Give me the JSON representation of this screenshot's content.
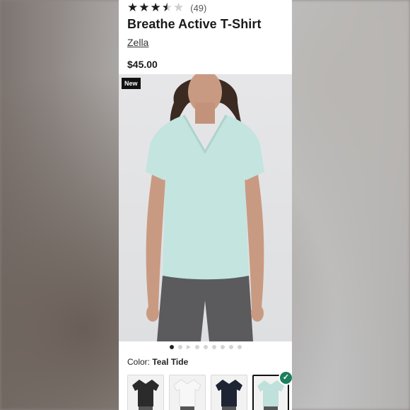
{
  "product": {
    "rating_count": "(49)",
    "title": "Breathe Active T-Shirt",
    "brand": "Zella",
    "price": "$45.00",
    "badge": "New"
  },
  "rating": {
    "stars": 3.5,
    "max": 5,
    "icons": [
      "star-icon",
      "star-icon",
      "star-icon",
      "star-half-icon",
      "star-empty-icon"
    ]
  },
  "gallery": {
    "images_total": 9,
    "current": 1,
    "has_video": true
  },
  "color": {
    "label": "Color:",
    "selected_name": "Teal Tide",
    "swatches": [
      {
        "name": "Black",
        "shirt": "#2b2b2b"
      },
      {
        "name": "White",
        "shirt": "#f4f4f4"
      },
      {
        "name": "Navy",
        "shirt": "#1f2435"
      },
      {
        "name": "Teal Tide",
        "shirt": "#bfe0db",
        "selected": true
      }
    ]
  },
  "colors": {
    "check_badge": "#1d7f5e",
    "shirt_main": "#c3e4df",
    "leggings": "#5b5a5c"
  }
}
